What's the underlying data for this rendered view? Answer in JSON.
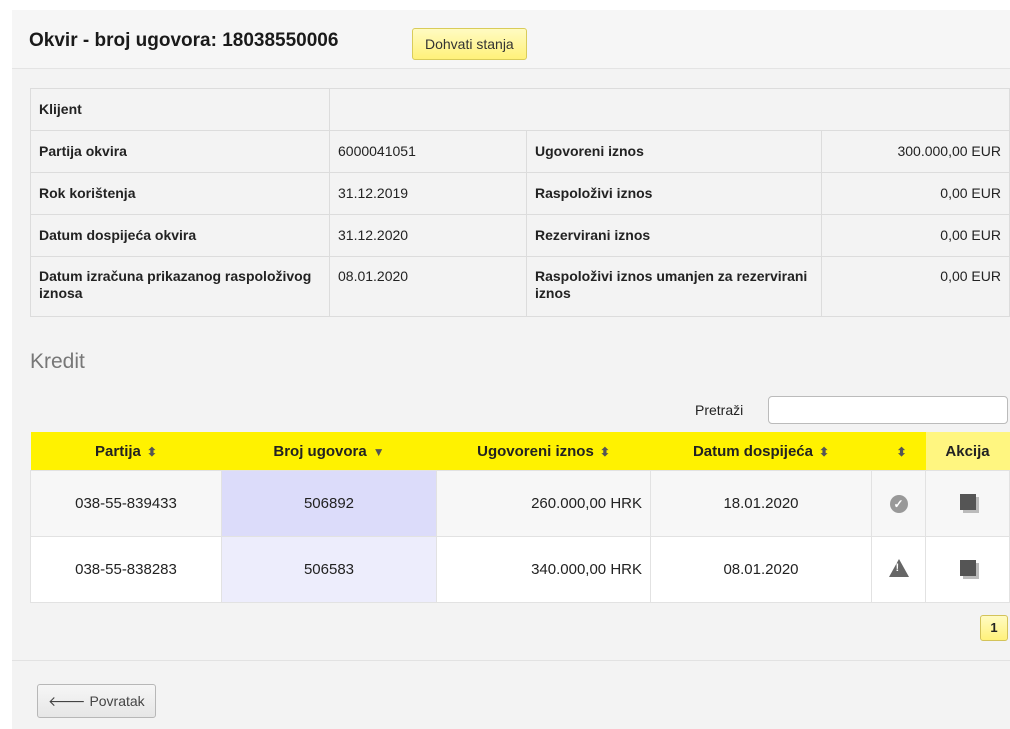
{
  "header": {
    "title": "Okvir - broj ugovora: 18038550006",
    "fetch_button": "Dohvati stanja"
  },
  "info": {
    "client_label": "Klijent",
    "client_value": "",
    "rows": [
      {
        "l1": "Partija okvira",
        "v1": "6000041051",
        "l2": "Ugovoreni iznos",
        "v2": "300.000,00 EUR"
      },
      {
        "l1": "Rok korištenja",
        "v1": "31.12.2019",
        "l2": "Raspoloživi iznos",
        "v2": "0,00 EUR"
      },
      {
        "l1": "Datum dospijeća okvira",
        "v1": "31.12.2020",
        "l2": "Rezervirani iznos",
        "v2": "0,00 EUR"
      },
      {
        "l1": "Datum izračuna prikazanog raspoloživog iznosa",
        "v1": "08.01.2020",
        "l2": "Raspoloživi iznos umanjen za rezervirani iznos",
        "v2": "0,00 EUR"
      }
    ]
  },
  "credit": {
    "section_title": "Kredit",
    "search_label": "Pretraži",
    "search_value": "",
    "columns": [
      "Partija",
      "Broj ugovora",
      "Ugovoreni iznos",
      "Datum dospijeća",
      "",
      "Akcija"
    ],
    "rows": [
      {
        "partija": "038-55-839433",
        "broj": "506892",
        "iznos": "260.000,00 HRK",
        "datum": "18.01.2020",
        "status_icon": "check-circle-icon",
        "action_icon": "copy-icon"
      },
      {
        "partija": "038-55-838283",
        "broj": "506583",
        "iznos": "340.000,00 HRK",
        "datum": "08.01.2020",
        "status_icon": "warning-icon",
        "action_icon": "copy-icon"
      }
    ],
    "pager_page": "1"
  },
  "footer": {
    "back_button": "Povratak",
    "back_icon": "arrow-left-icon"
  },
  "colors": {
    "header_bg": "#fff200",
    "button_yellow": "#fff17a",
    "sorted_column": "#dcdcfa"
  }
}
